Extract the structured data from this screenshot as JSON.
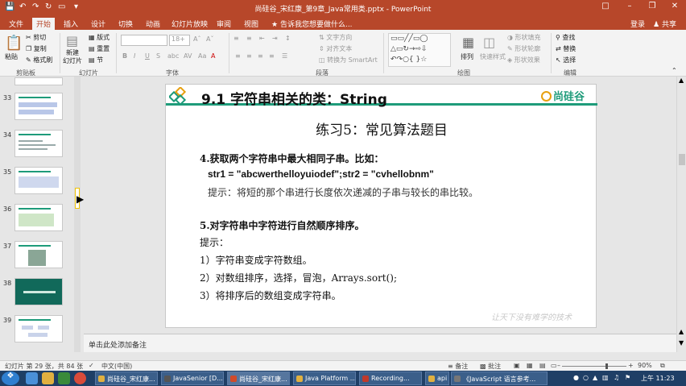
{
  "titlebar": {
    "title": "尚硅谷_宋红康_第9章_Java常用类.pptx - PowerPoint",
    "sign_in": "登录",
    "share": "共享"
  },
  "tabs": [
    {
      "label": "文件"
    },
    {
      "label": "开始"
    },
    {
      "label": "插入"
    },
    {
      "label": "设计"
    },
    {
      "label": "切换"
    },
    {
      "label": "动画"
    },
    {
      "label": "幻灯片放映"
    },
    {
      "label": "审阅"
    },
    {
      "label": "视图"
    },
    {
      "label": "告诉我您想要做什么..."
    }
  ],
  "ribbon": {
    "clipboard": {
      "paste": "粘贴",
      "cut": "剪切",
      "copy": "复制",
      "format_painter": "格式刷",
      "group": "剪贴板"
    },
    "slides": {
      "new_slide": "新建\n幻灯片",
      "layout": "版式",
      "reset": "重置",
      "section": "节",
      "group": "幻灯片"
    },
    "font": {
      "font_name": "",
      "font_size": "18+",
      "group": "字体"
    },
    "paragraph": {
      "text_direction": "文字方向",
      "align_text": "对齐文本",
      "smartart": "转换为 SmartArt",
      "group": "段落"
    },
    "drawing": {
      "arrange": "排列",
      "quick_styles": "快速样式",
      "shape_fill": "形状填充",
      "shape_outline": "形状轮廓",
      "shape_effects": "形状效果",
      "group": "绘图"
    },
    "editing": {
      "find": "查找",
      "replace": "替换",
      "select": "选择",
      "group": "编辑"
    }
  },
  "thumbnails": [
    {
      "num": "33"
    },
    {
      "num": "34"
    },
    {
      "num": "35"
    },
    {
      "num": "36"
    },
    {
      "num": "37"
    },
    {
      "num": "38"
    },
    {
      "num": "39"
    }
  ],
  "slide": {
    "heading": "9.1 字符串相关的类：String",
    "logo": "尚硅谷",
    "subhead": "练习5：常见算法题目",
    "lines": [
      "4.获取两个字符串中最大相同子串。比如：",
      "str1 = \"abcwerthelloyuiodef\";str2 = \"cvhellobnm\"",
      "提示：将短的那个串进行长度依次递减的子串与较长的串比较。",
      "5.对字符串中字符进行自然顺序排序。",
      "提示：",
      "1）字符串变成字符数组。",
      "2）对数组排序，选择，冒泡，Arrays.sort();",
      "3）将排序后的数组变成字符串。"
    ],
    "watermark": "让天下没有难学的技术"
  },
  "notes": {
    "placeholder": "单击此处添加备注"
  },
  "status": {
    "slide_info": "幻灯片 第 29 张，共 84 张",
    "language": "中文(中国)",
    "notes_btn": "备注",
    "comments_btn": "批注",
    "zoom": "90%"
  },
  "taskbar": {
    "buttons": [
      {
        "label": "尚硅谷_宋红康..."
      },
      {
        "label": "JavaSenior [D..."
      },
      {
        "label": "尚硅谷_宋红康..."
      },
      {
        "label": "Java Platform ..."
      },
      {
        "label": "Recording..."
      },
      {
        "label": "api"
      },
      {
        "label": "《JavaScript 语言参考..."
      }
    ],
    "clock": "上午 11:23"
  }
}
